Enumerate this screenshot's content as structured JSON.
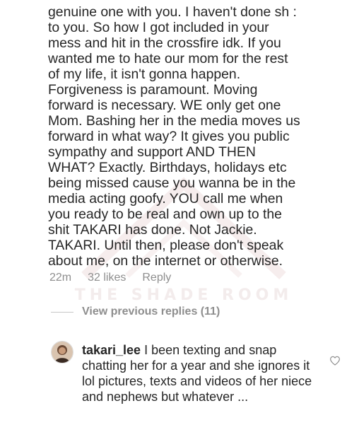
{
  "comment": {
    "lines": [
      "genuine one with you. I haven't done sh :",
      "to you. So how I got included in your",
      "mess and hit in the crossfire idk. If you",
      "wanted me to hate our mom for the rest",
      "of my life, it isn't gonna happen.",
      "Forgiveness is paramount. Moving",
      "forward is necessary. WE only get one",
      "Mom. Bashing her in the media moves us",
      "forward in what way? It gives you public",
      "sympathy and support AND THEN",
      "WHAT?  Exactly. Birthdays, holidays etc",
      "being missed cause you wanna be in the",
      "media acting goofy. YOU call me when",
      "you ready to be real and own up to the",
      "shit TAKARI has done. Not Jackie.",
      "TAKARI. Until then, please don't speak",
      "about me, on the internet or otherwise."
    ],
    "time": "22m",
    "likes": "32 likes",
    "reply_label": "Reply"
  },
  "view_replies_label": "View previous replies (11)",
  "reply": {
    "username": "takari_lee",
    "text": "I been texting and snap chatting her for a year and she ignores it lol pictures, texts and videos of her niece and nephews but whatever ..."
  },
  "watermark": "THE SHADE ROOM",
  "icons": {
    "like": "heart-icon",
    "avatar": "avatar"
  },
  "colors": {
    "text": "#262626",
    "secondary": "#8e8e8e",
    "watermark": "#f3ecec"
  }
}
